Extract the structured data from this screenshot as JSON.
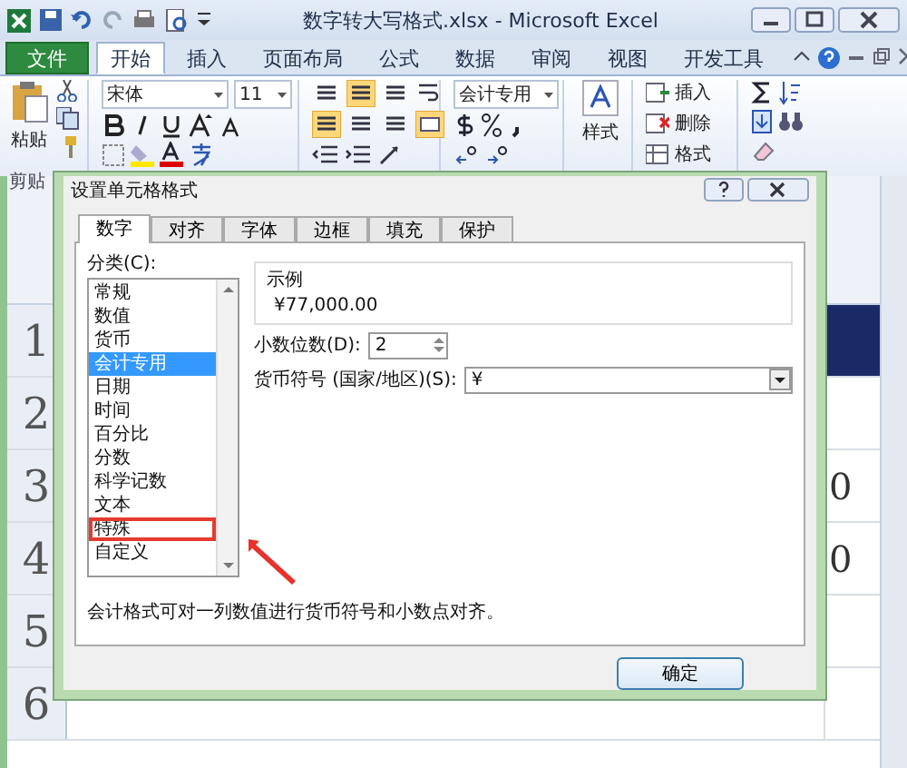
{
  "window": {
    "title": "数字转大写格式.xlsx - Microsoft Excel"
  },
  "ribbon_tabs": [
    {
      "label": "文件",
      "kind": "file",
      "selected": false
    },
    {
      "label": "开始",
      "kind": "tab",
      "selected": true
    },
    {
      "label": "插入",
      "kind": "tab",
      "selected": false
    },
    {
      "label": "页面布局",
      "kind": "tab",
      "selected": false
    },
    {
      "label": "公式",
      "kind": "tab",
      "selected": false
    },
    {
      "label": "数据",
      "kind": "tab",
      "selected": false
    },
    {
      "label": "审阅",
      "kind": "tab",
      "selected": false
    },
    {
      "label": "视图",
      "kind": "tab",
      "selected": false
    },
    {
      "label": "开发工具",
      "kind": "tab",
      "selected": false
    }
  ],
  "ribbon": {
    "paste_label": "粘贴",
    "font_name": "宋体",
    "font_size": "11",
    "number_format": "会计专用",
    "styles_label": "样式",
    "cell_commands": [
      "插入",
      "删除",
      "格式"
    ],
    "clipboard_group": "剪贴"
  },
  "sheet": {
    "rows": [
      {
        "header": "1",
        "filled": true
      },
      {
        "header": "2",
        "filled": false
      },
      {
        "header": "3",
        "filled": false,
        "value": "0"
      },
      {
        "header": "4",
        "filled": false,
        "value": "0"
      },
      {
        "header": "5",
        "filled": false
      },
      {
        "header": "6",
        "filled": false
      }
    ]
  },
  "dialog": {
    "title": "设置单元格格式",
    "tabs": [
      {
        "label": "数字",
        "selected": true
      },
      {
        "label": "对齐",
        "selected": false
      },
      {
        "label": "字体",
        "selected": false
      },
      {
        "label": "边框",
        "selected": false
      },
      {
        "label": "填充",
        "selected": false
      },
      {
        "label": "保护",
        "selected": false
      }
    ],
    "category_label": "分类(C):",
    "categories": [
      {
        "label": "常规",
        "selected": false,
        "highlighted": false
      },
      {
        "label": "数值",
        "selected": false,
        "highlighted": false
      },
      {
        "label": "货币",
        "selected": false,
        "highlighted": false
      },
      {
        "label": "会计专用",
        "selected": true,
        "highlighted": false
      },
      {
        "label": "日期",
        "selected": false,
        "highlighted": false
      },
      {
        "label": "时间",
        "selected": false,
        "highlighted": false
      },
      {
        "label": "百分比",
        "selected": false,
        "highlighted": false
      },
      {
        "label": "分数",
        "selected": false,
        "highlighted": false
      },
      {
        "label": "科学记数",
        "selected": false,
        "highlighted": false
      },
      {
        "label": "文本",
        "selected": false,
        "highlighted": false
      },
      {
        "label": "特殊",
        "selected": false,
        "highlighted": true
      },
      {
        "label": "自定义",
        "selected": false,
        "highlighted": false
      }
    ],
    "sample_label": "示例",
    "sample_value": "¥77,000.00",
    "decimal_label": "小数位数(D):",
    "decimal_value": "2",
    "currency_label": "货币符号 (国家/地区)(S):",
    "currency_value": "¥",
    "description": "会计格式可对一列数值进行货币符号和小数点对齐。",
    "ok_button": "确定"
  }
}
